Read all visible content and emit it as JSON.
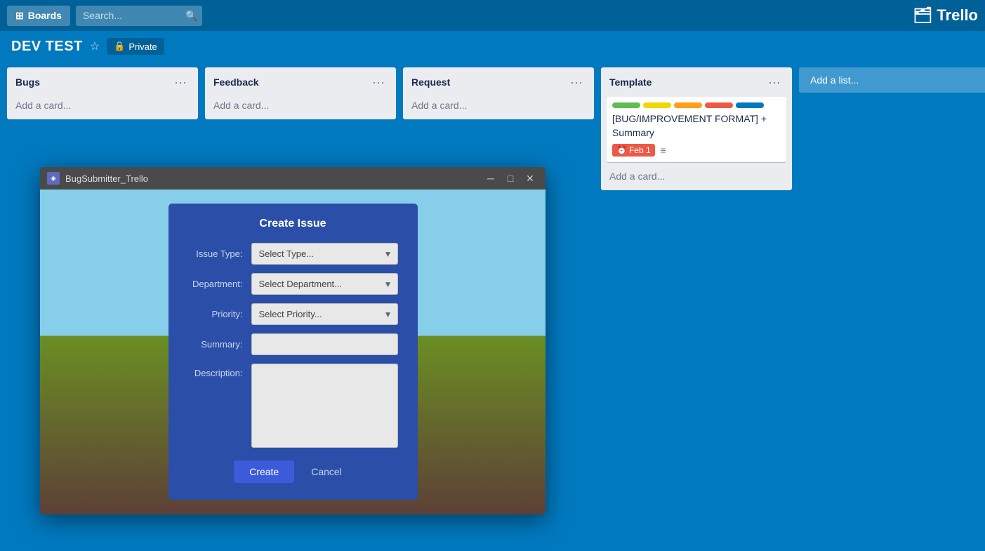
{
  "topNav": {
    "boards_label": "Boards",
    "search_placeholder": "Search...",
    "trello_logo": "Trello"
  },
  "boardHeader": {
    "title": "DEV TEST",
    "visibility": "Private"
  },
  "lists": [
    {
      "id": "bugs",
      "title": "Bugs",
      "add_card_label": "Add a card...",
      "cards": []
    },
    {
      "id": "feedback",
      "title": "Feedback",
      "add_card_label": "Add a card...",
      "cards": []
    },
    {
      "id": "request",
      "title": "Request",
      "add_card_label": "Add a card...",
      "cards": []
    },
    {
      "id": "template",
      "title": "Template",
      "add_card_label": "Add a card...",
      "cards": [
        {
          "labels": [
            "green",
            "yellow",
            "orange",
            "red",
            "blue"
          ],
          "title": "[BUG/IMPROVEMENT FORMAT] + Summary",
          "due": "Feb 1",
          "has_desc": true
        }
      ]
    }
  ],
  "add_list_label": "Add a list...",
  "dialog": {
    "title": "Create Issue",
    "fields": {
      "issue_type_label": "Issue Type:",
      "issue_type_placeholder": "Select Type...",
      "department_label": "Department:",
      "department_placeholder": "Select Department...",
      "priority_label": "Priority:",
      "priority_placeholder": "Select Priority...",
      "summary_label": "Summary:",
      "description_label": "Description:"
    },
    "create_label": "Create",
    "cancel_label": "Cancel"
  },
  "window": {
    "title": "BugSubmitter_Trello",
    "icon": "◈"
  }
}
